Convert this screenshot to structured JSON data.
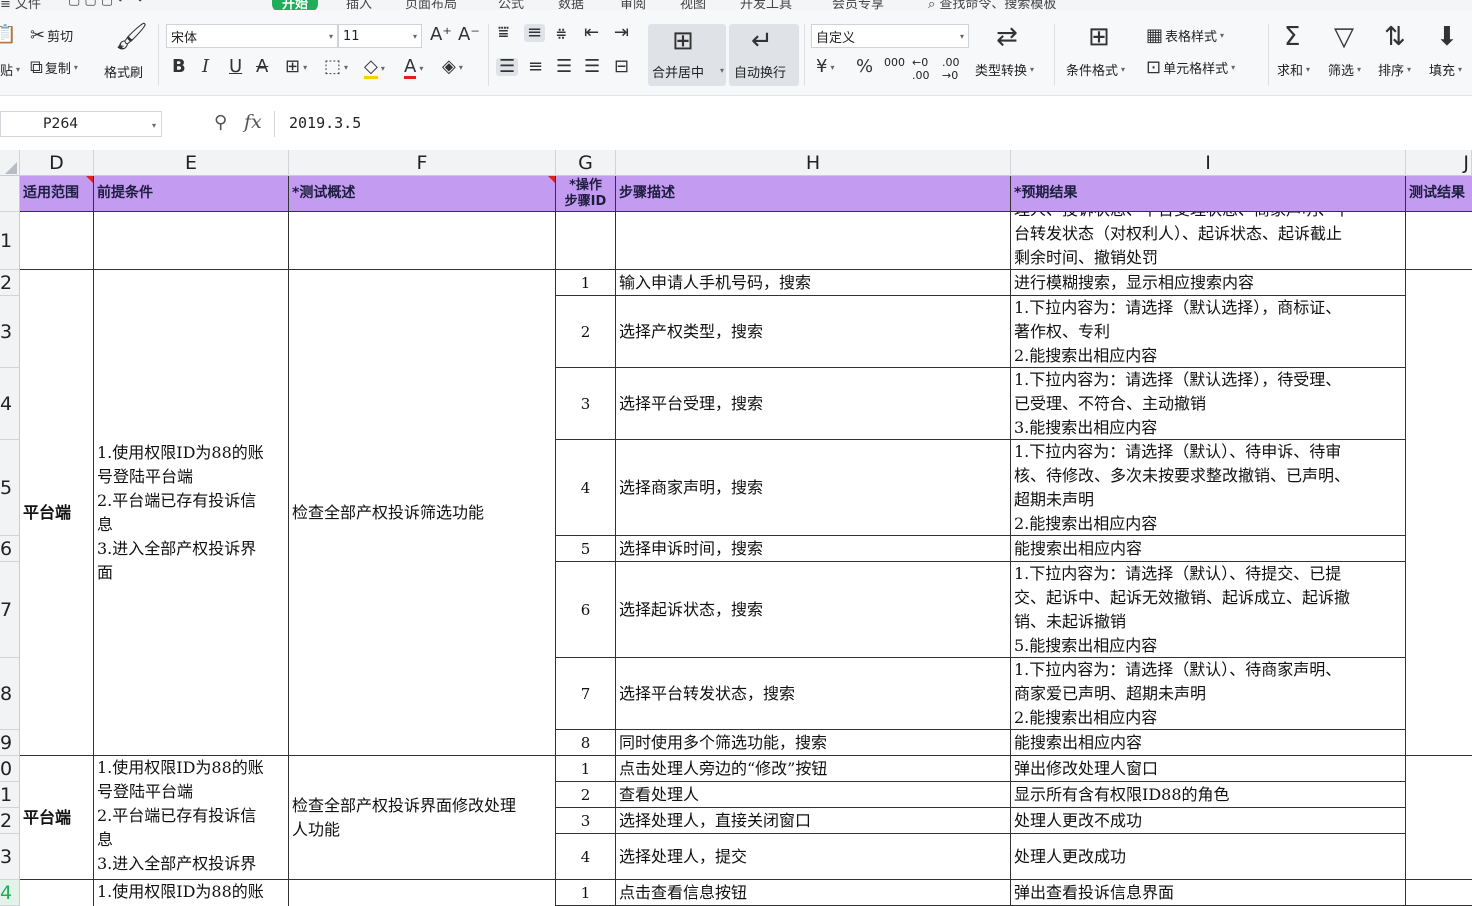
{
  "tabs": {
    "file": "文件",
    "home": "开始",
    "insert": "插入",
    "page_layout": "页面布局",
    "formula": "公式",
    "data": "数据",
    "review": "审阅",
    "view": "视图",
    "dev_tools": "开发工具",
    "member": "会员专享",
    "search_placeholder": "查找命令、搜索模板"
  },
  "ribbon": {
    "paste": "贴",
    "cut": "剪切",
    "copy": "复制",
    "format_painter": "格式刷",
    "font_name": "宋体",
    "font_size": "11",
    "merge_center": "合并居中",
    "wrap_text": "自动换行",
    "number_format": "自定义",
    "type_convert": "类型转换",
    "conditional_format": "条件格式",
    "table_style": "表格样式",
    "cell_style": "单元格样式",
    "sum": "求和",
    "filter": "筛选",
    "sort": "排序",
    "fill": "填充",
    "currency_symbol": "¥",
    "percent_symbol": "%",
    "thousands_symbol": "000"
  },
  "formula_bar": {
    "cell_ref": "P264",
    "fx": "fx",
    "value": "2019.3.5"
  },
  "columns": [
    "D",
    "E",
    "F",
    "G",
    "H",
    "I",
    "J"
  ],
  "row_numbers": [
    "1",
    "2",
    "3",
    "4",
    "5",
    "6",
    "7",
    "8",
    "9",
    "0",
    "1",
    "2",
    "3",
    "4"
  ],
  "header_row": {
    "scope": "适用范围",
    "precondition": "前提条件",
    "overview": "*测试概述",
    "step_id_1": "*操作",
    "step_id_2": "步骤ID",
    "step_desc": "步骤描述",
    "expected": "*预期结果",
    "result": "测试结果"
  },
  "top_partial": {
    "line0": "理人、投诉状态、平台受理状态、商家声明、平",
    "line1": "台转发状态（对权利人）、起诉状态、起诉截止",
    "line2": "剩余时间、撤销处罚"
  },
  "group1": {
    "scope": "平台端",
    "pre": [
      "1.使用权限ID为88的账",
      "号登陆平台端",
      "2.平台端已存有投诉信",
      "息",
      "3.进入全部产权投诉界",
      "面"
    ],
    "overview": "检查全部产权投诉筛选功能",
    "steps": [
      {
        "id": "1",
        "desc": "输入申请人手机号码，搜索",
        "exp": [
          "进行模糊搜索，显示相应搜索内容"
        ]
      },
      {
        "id": "2",
        "desc": "选择产权类型，搜索",
        "exp": [
          "1.下拉内容为：请选择（默认选择），商标证、",
          "著作权、专利",
          "2.能搜索出相应内容"
        ]
      },
      {
        "id": "3",
        "desc": "选择平台受理，搜索",
        "exp": [
          "1.下拉内容为：请选择（默认选择），待受理、",
          "已受理、不符合、主动撤销",
          "3.能搜索出相应内容"
        ]
      },
      {
        "id": "4",
        "desc": "选择商家声明，搜索",
        "exp": [
          "1.下拉内容为：请选择（默认）、待申诉、待审",
          "核、待修改、多次未按要求整改撤销、已声明、",
          "超期未声明",
          "2.能搜索出相应内容"
        ]
      },
      {
        "id": "5",
        "desc": "选择申诉时间，搜索",
        "exp": [
          "能搜索出相应内容"
        ]
      },
      {
        "id": "6",
        "desc": "选择起诉状态，搜索",
        "exp": [
          "1.下拉内容为：请选择（默认）、待提交、已提",
          "交、起诉中、起诉无效撤销、起诉成立、起诉撤",
          "销、未起诉撤销",
          "5.能搜索出相应内容"
        ]
      },
      {
        "id": "7",
        "desc": "选择平台转发状态，搜索",
        "exp": [
          "1.下拉内容为：请选择（默认）、待商家声明、",
          "商家爱已声明、超期未声明",
          "2.能搜索出相应内容"
        ]
      },
      {
        "id": "8",
        "desc": "同时使用多个筛选功能，搜索",
        "exp": [
          "能搜索出相应内容"
        ]
      }
    ]
  },
  "group2": {
    "scope": "平台端",
    "pre": [
      "1.使用权限ID为88的账",
      "号登陆平台端",
      "2.平台端已存有投诉信",
      "息",
      "3.进入全部产权投诉界"
    ],
    "overview": [
      "检查全部产权投诉界面修改处理",
      "人功能"
    ],
    "steps": [
      {
        "id": "1",
        "desc": "点击处理人旁边的“修改”按钮",
        "exp": [
          "弹出修改处理人窗口"
        ]
      },
      {
        "id": "2",
        "desc": "查看处理人",
        "exp": [
          "显示所有含有权限ID88的角色"
        ]
      },
      {
        "id": "3",
        "desc": "选择处理人，直接关闭窗口",
        "exp": [
          "处理人更改不成功"
        ]
      },
      {
        "id": "4",
        "desc": "选择处理人，提交",
        "exp": [
          "处理人更改成功"
        ]
      }
    ]
  },
  "group3": {
    "pre": [
      "1.使用权限ID为88的账"
    ],
    "steps": [
      {
        "id": "1",
        "desc": "点击查看信息按钮",
        "exp": [
          "弹出查看投诉信息界面"
        ]
      }
    ]
  },
  "colors": {
    "header_bg": "#c39bf0",
    "active_tab": "#1fad5a",
    "selected_row": "#1fad5a"
  }
}
